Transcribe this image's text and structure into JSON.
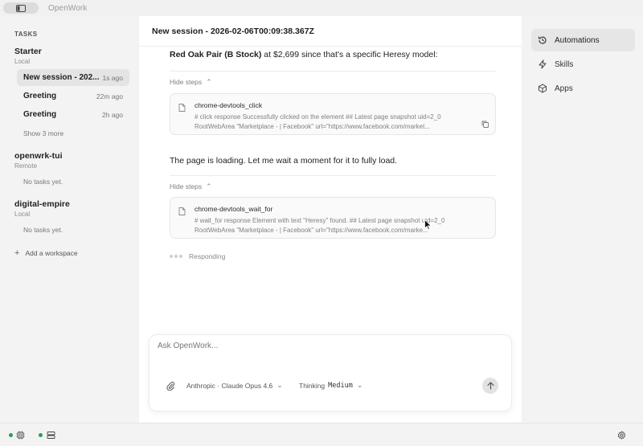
{
  "app": {
    "title": "OpenWork"
  },
  "sidebar": {
    "section_label": "TASKS",
    "workspaces": [
      {
        "name": "Starter",
        "location": "Local",
        "tasks": [
          {
            "title": "New session - 202...",
            "time": "1s ago",
            "active": true
          },
          {
            "title": "Greeting",
            "time": "22m ago"
          },
          {
            "title": "Greeting",
            "time": "2h ago"
          }
        ],
        "show_more": "Show 3 more"
      },
      {
        "name": "openwrk-tui",
        "location": "Remote",
        "empty_text": "No tasks yet."
      },
      {
        "name": "digital-empire",
        "location": "Local",
        "empty_text": "No tasks yet."
      }
    ],
    "add_workspace": "Add a workspace"
  },
  "session": {
    "title": "New session - 2026-02-06T00:09:38.367Z",
    "messages": [
      {
        "bold": "Red Oak Pair (B Stock)",
        "text": " at $2,699 since that's a specific Heresy model:"
      },
      {
        "text": "The page is loading. Let me wait a moment for it to fully load."
      }
    ],
    "hide_steps_label": "Hide steps",
    "steps": [
      {
        "name": "chrome-devtools_click",
        "output_line1": "# click response Successfully clicked on the element ## Latest page snapshot uid=2_0",
        "output_line2": "RootWebArea \"Marketplace - | Facebook\" url=\"https://www.facebook.com/market..."
      },
      {
        "name": "chrome-devtools_wait_for",
        "output_line1": "# wait_for response Element with text \"Heresy\" found. ## Latest page snapshot uid=2_0",
        "output_line2": "RootWebArea \"Marketplace - | Facebook\" url=\"https://www.facebook.com/marke..."
      }
    ],
    "status": "Responding"
  },
  "composer": {
    "placeholder": "Ask OpenWork...",
    "model": "Anthropic · Claude Opus 4.6",
    "thinking_label": "Thinking",
    "thinking_level": "Medium"
  },
  "right_panel": {
    "items": [
      {
        "label": "Automations",
        "icon": "history-icon",
        "active": true
      },
      {
        "label": "Skills",
        "icon": "lightning-icon"
      },
      {
        "label": "Apps",
        "icon": "cube-icon"
      }
    ]
  },
  "colors": {
    "status_green": "#2e9a5c"
  }
}
